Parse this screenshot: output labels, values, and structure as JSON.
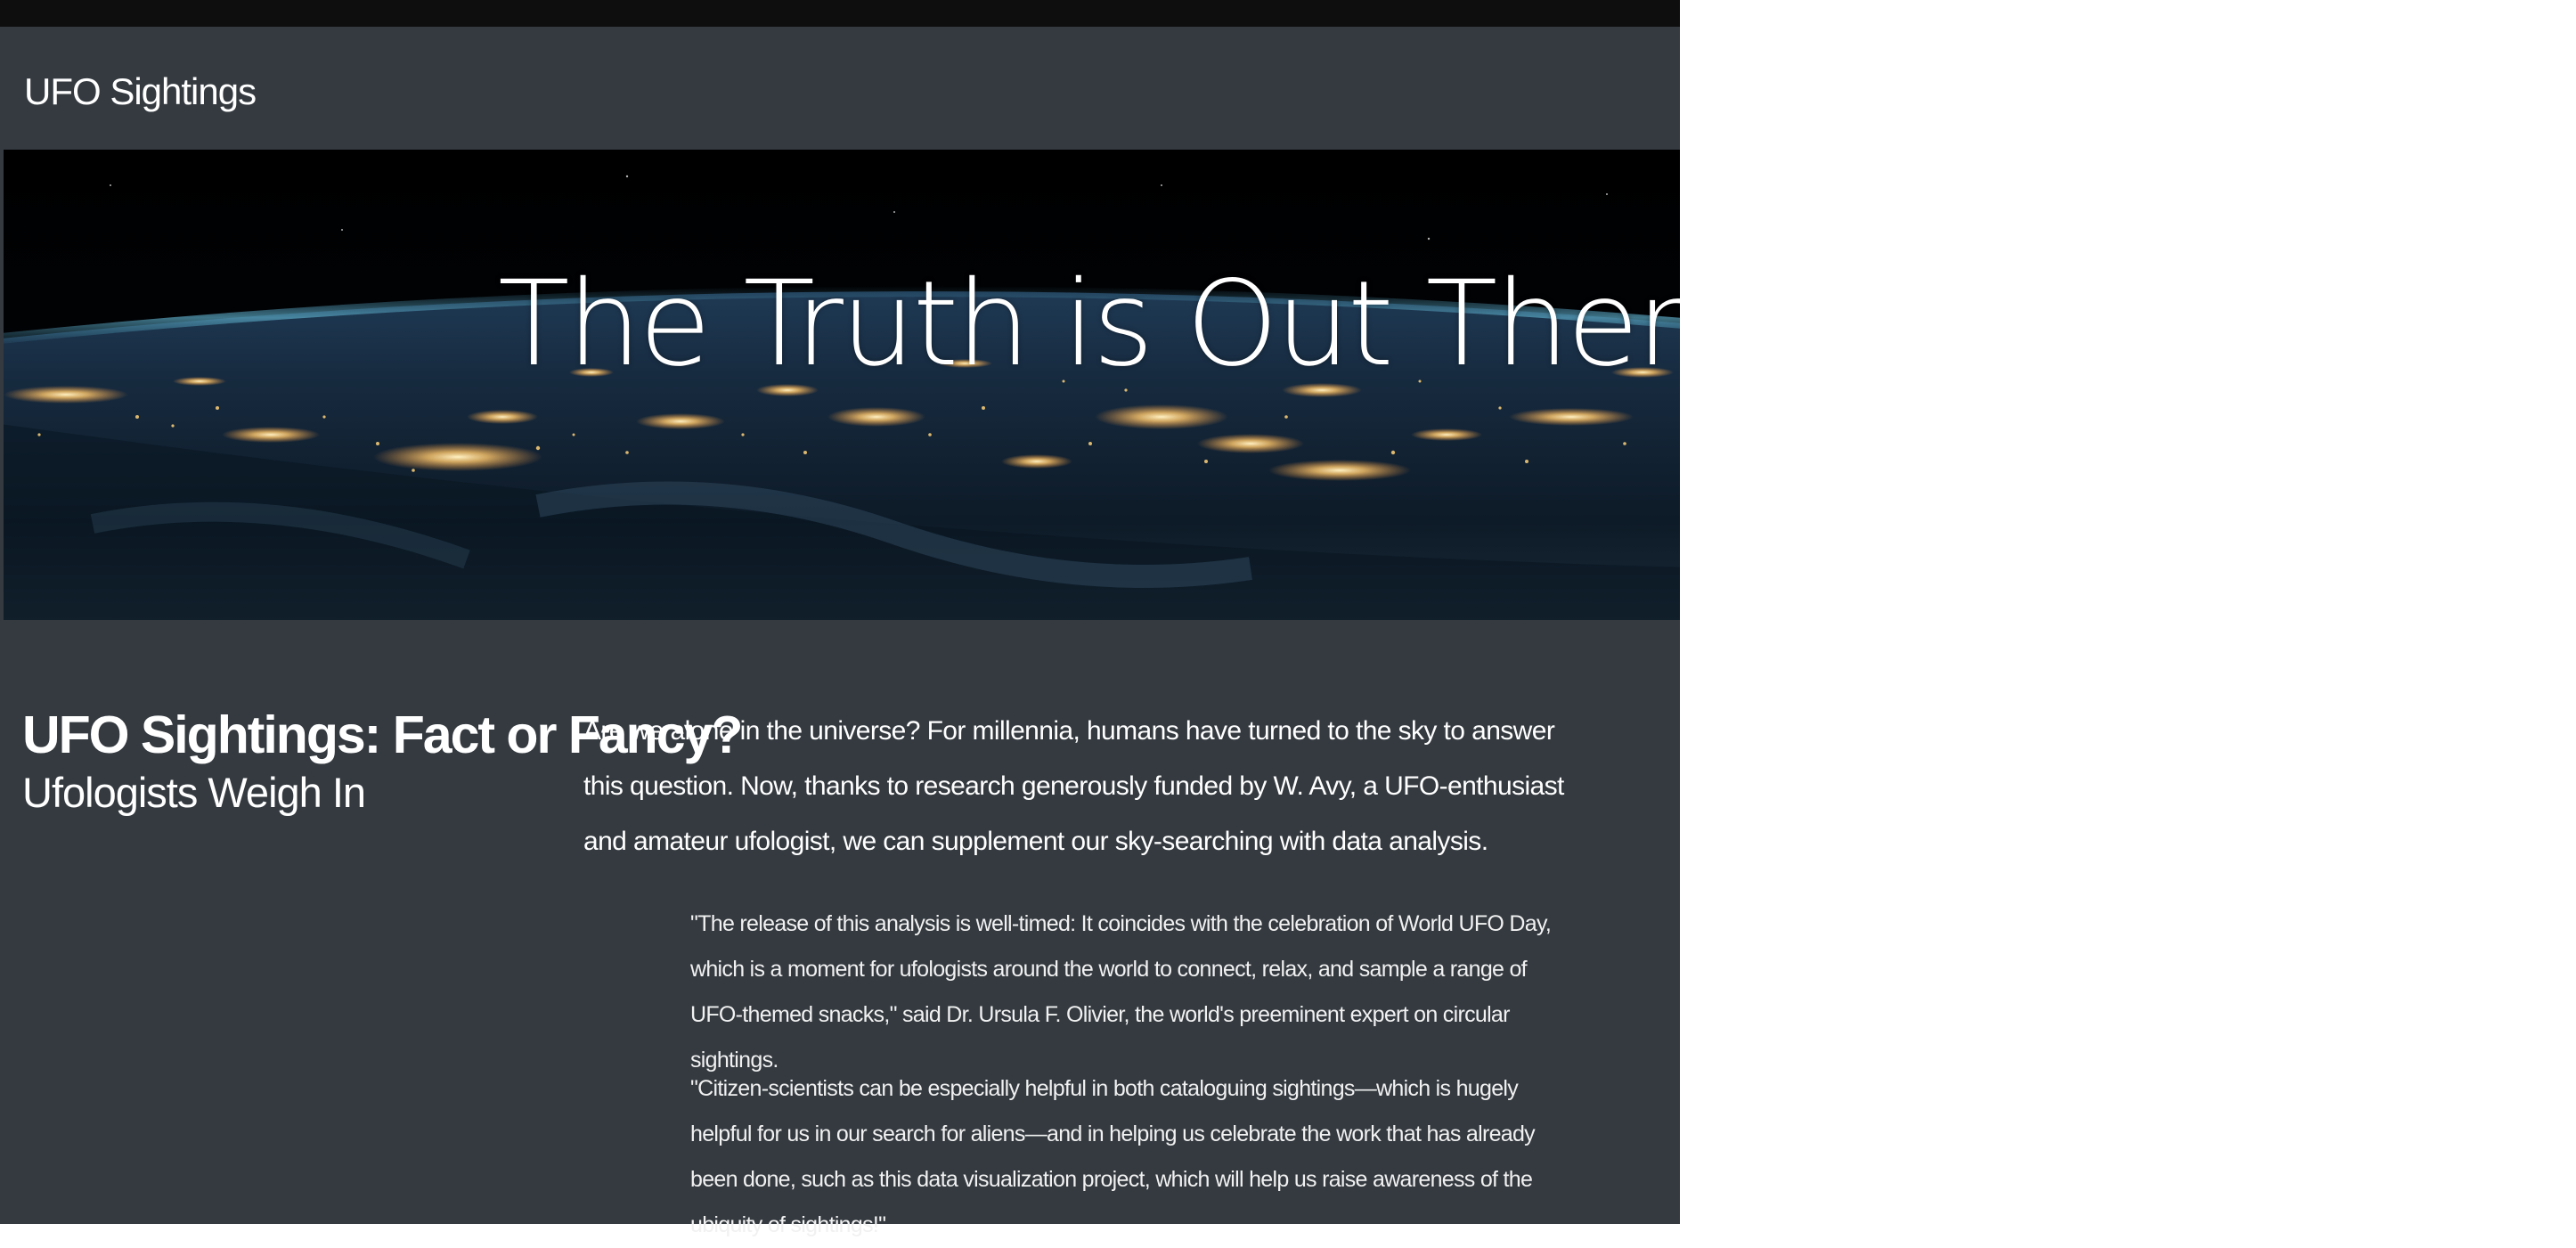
{
  "navbar": {
    "brand": "UFO Sightings"
  },
  "hero": {
    "title": "The Truth is Out There"
  },
  "article": {
    "headline": "UFO Sightings: Fact or Fancy?",
    "subheadline": "Ufologists Weigh In",
    "intro": "Are we alone in the universe? For millennia, humans have turned to the sky to answer this question. Now, thanks to research generously funded by W. Avy, a UFO-enthusiast and amateur ufologist, we can supplement our sky-searching with data analysis.",
    "quotes": [
      "\"The release of this analysis is well-timed: It coincides with the celebration of World UFO Day, which is a moment for ufologists around the world to connect, relax, and sample a range of UFO-themed snacks,\" said Dr. Ursula F. Olivier, the world's preeminent expert on circular sightings.",
      "\"Citizen-scientists can be especially helpful in both cataloguing sightings—which is hugely helpful for us in our search for aliens—and in helping us celebrate the work that has already been done, such as this data visualization project, which will help us raise awareness of the ubiquity of sightings!\""
    ]
  },
  "colors": {
    "background": "#343a40",
    "topbar": "#0e0e0e",
    "text": "#ffffff",
    "city_lights": "#ffd27a"
  }
}
